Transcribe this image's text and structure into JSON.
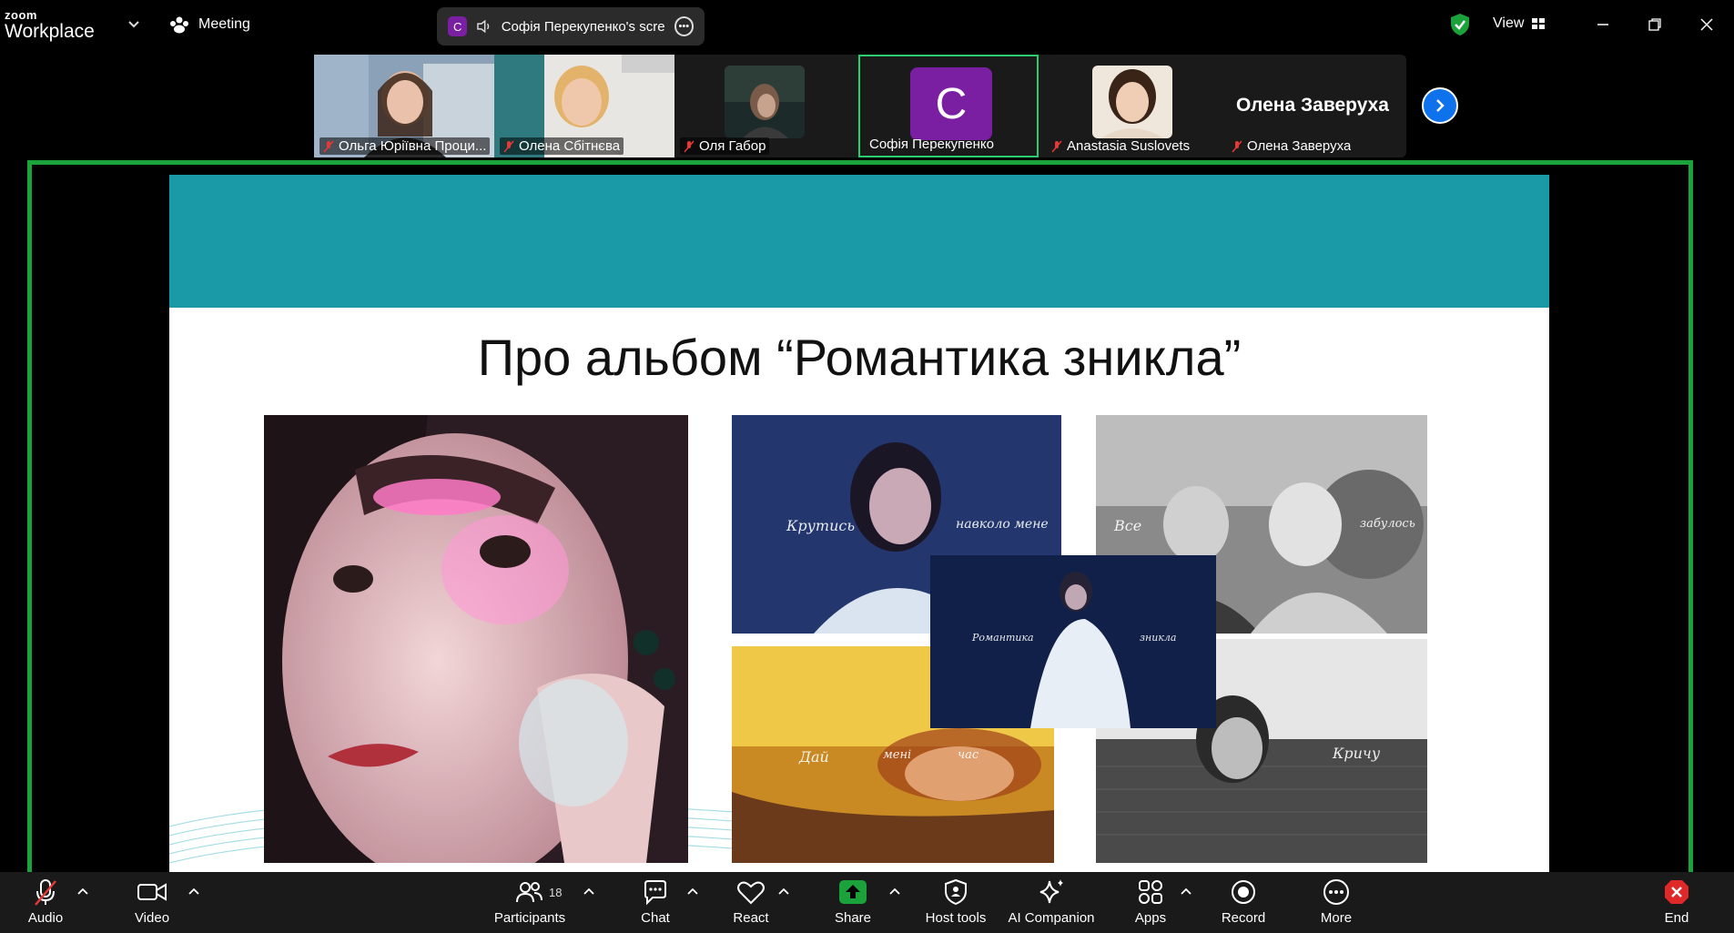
{
  "titlebar": {
    "brand_small": "zoom",
    "brand_big": "Workplace",
    "meeting_label": "Meeting",
    "share_avatar_letter": "C",
    "share_label": "Софія Перекупенко's screen",
    "view_label": "View",
    "shield_color": "#1ba23a"
  },
  "participants_strip": [
    {
      "name": "Ольга Юріївна Проци..."
    },
    {
      "name": "Олена Сбітнєва"
    },
    {
      "name": "Оля Габор"
    },
    {
      "name": "Софія Перекупенко",
      "avatar_letter": "C",
      "active": true
    },
    {
      "name": "Anastasia Suslovets"
    },
    {
      "name": "Олена Заверуха",
      "big_name": "Олена Заверуха"
    }
  ],
  "slide": {
    "title": "Про альбом “Романтика зникла”",
    "captions": {
      "photo2_left": "Крутись",
      "photo2_right": "навколо мене",
      "photo3_left": "Все",
      "photo3_right": "забулось",
      "photo4_left": "Романтика",
      "photo4_right": "зникла",
      "photo5_a": "Дай",
      "photo5_b": "мені",
      "photo5_c": "час",
      "photo6": "Кричу"
    },
    "band_color": "#1a9aa6"
  },
  "toolbar": {
    "audio": "Audio",
    "video": "Video",
    "participants": "Participants",
    "participants_count": "18",
    "chat": "Chat",
    "react": "React",
    "share": "Share",
    "host_tools": "Host tools",
    "ai_companion": "AI Companion",
    "apps": "Apps",
    "record": "Record",
    "more": "More",
    "end": "End"
  }
}
